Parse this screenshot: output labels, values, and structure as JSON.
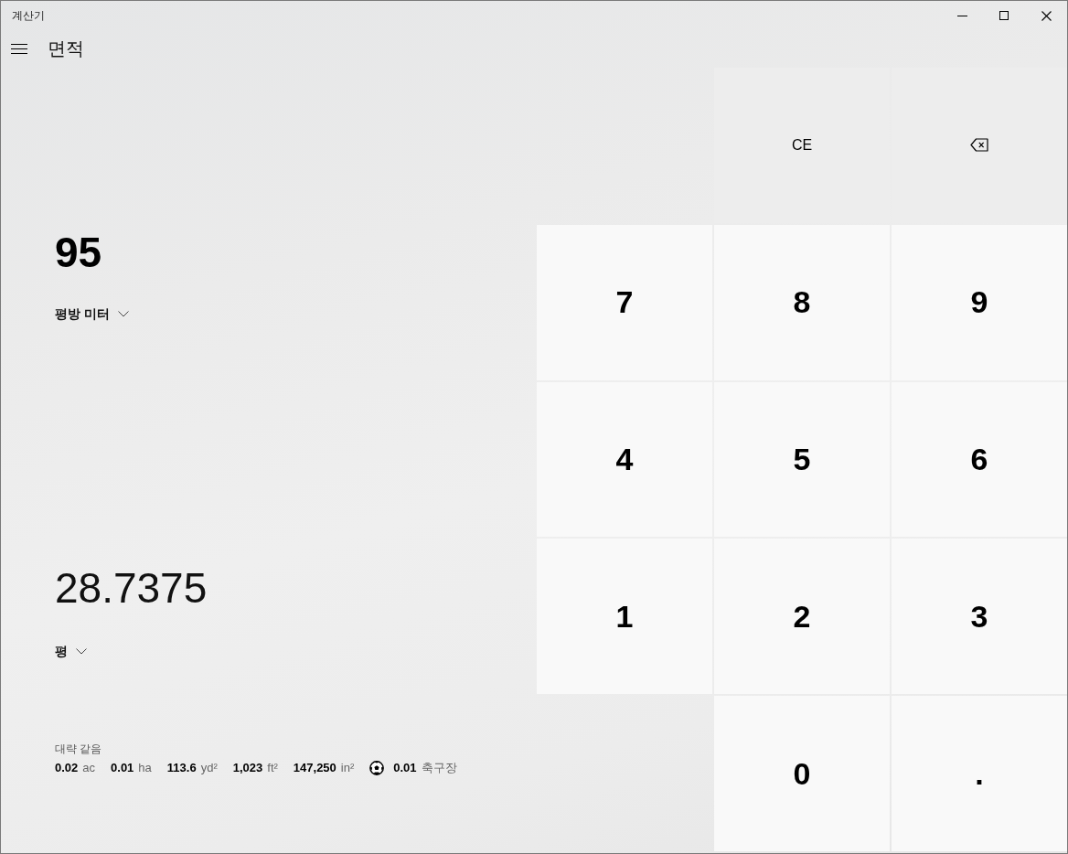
{
  "window": {
    "title": "계산기"
  },
  "header": {
    "title": "면적"
  },
  "displays": [
    {
      "value": "95",
      "unit": "평방 미터",
      "selected": true
    },
    {
      "value": "28.7375",
      "unit": "평",
      "selected": false
    }
  ],
  "equivalents": {
    "label": "대략 같음",
    "items": [
      {
        "kind": "plain",
        "value": "0.02",
        "unit": "ac"
      },
      {
        "kind": "plain",
        "value": "0.01",
        "unit": "ha"
      },
      {
        "kind": "plain",
        "value": "113.6",
        "unit": "yd²"
      },
      {
        "kind": "plain",
        "value": "1,023",
        "unit": "ft²"
      },
      {
        "kind": "plain",
        "value": "147,250",
        "unit": "in²"
      },
      {
        "kind": "ball",
        "value": "0.01",
        "unit": "축구장"
      }
    ]
  },
  "keypad": {
    "rows": [
      {
        "keys": [
          {
            "kind": "text",
            "label": "CE"
          },
          {
            "kind": "backspace"
          }
        ]
      },
      {
        "keys": [
          {
            "kind": "digit",
            "label": "7"
          },
          {
            "kind": "digit",
            "label": "8"
          },
          {
            "kind": "digit",
            "label": "9"
          }
        ]
      },
      {
        "keys": [
          {
            "kind": "digit",
            "label": "4"
          },
          {
            "kind": "digit",
            "label": "5"
          },
          {
            "kind": "digit",
            "label": "6"
          }
        ]
      },
      {
        "keys": [
          {
            "kind": "digit",
            "label": "1"
          },
          {
            "kind": "digit",
            "label": "2"
          },
          {
            "kind": "digit",
            "label": "3"
          }
        ]
      },
      {
        "keys": [
          {
            "kind": "digit",
            "label": "0"
          },
          {
            "kind": "decimal",
            "label": "."
          }
        ]
      }
    ]
  }
}
